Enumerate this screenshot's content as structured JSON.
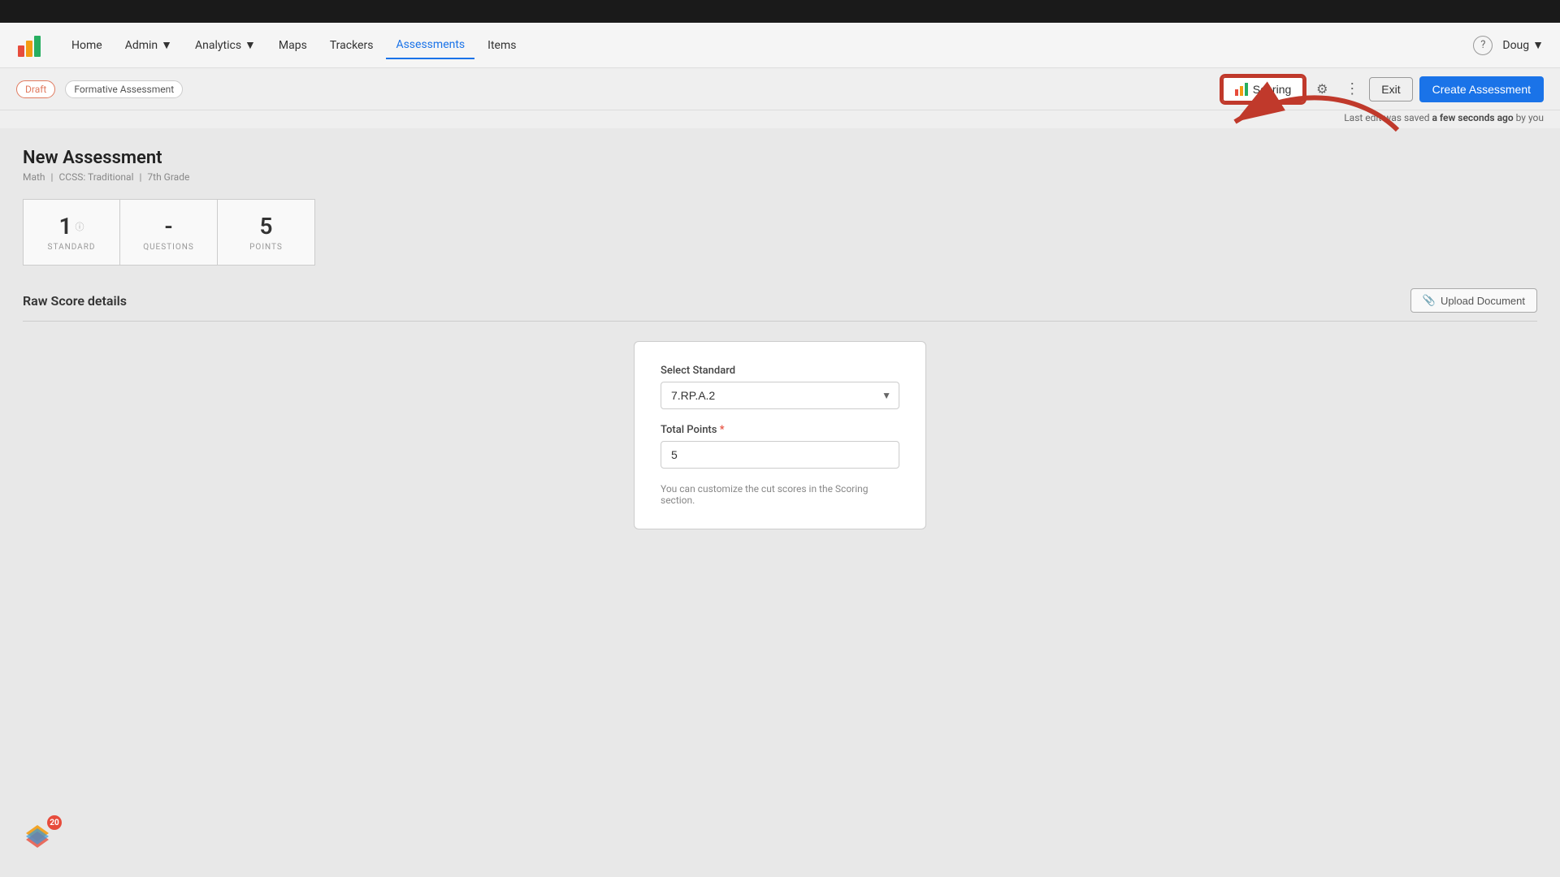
{
  "topbar": {},
  "navbar": {
    "logo_alt": "Logo",
    "links": [
      {
        "label": "Home",
        "active": false
      },
      {
        "label": "Admin",
        "active": false,
        "has_dropdown": true
      },
      {
        "label": "Analytics",
        "active": false,
        "has_dropdown": true
      },
      {
        "label": "Maps",
        "active": false
      },
      {
        "label": "Trackers",
        "active": false
      },
      {
        "label": "Assessments",
        "active": true
      },
      {
        "label": "Items",
        "active": false
      }
    ],
    "help_icon": "?",
    "user": {
      "name": "Doug",
      "dropdown": true
    }
  },
  "toolbar": {
    "badge_draft": "Draft",
    "badge_formative": "Formative Assessment",
    "scoring_label": "Scoring",
    "exit_label": "Exit",
    "create_label": "Create Assessment",
    "last_saved_prefix": "Last edit was saved ",
    "last_saved_bold": "a few seconds ago",
    "last_saved_suffix": " by you"
  },
  "assessment": {
    "title": "New Assessment",
    "meta_subject": "Math",
    "meta_separator1": "|",
    "meta_curriculum": "CCSS: Traditional",
    "meta_separator2": "|",
    "meta_grade": "7th Grade"
  },
  "stats": [
    {
      "number": "1",
      "label": "STANDARD",
      "has_info": true
    },
    {
      "number": "-",
      "label": "QUESTIONS",
      "has_info": false
    },
    {
      "number": "5",
      "label": "POINTS",
      "has_info": false
    }
  ],
  "raw_score": {
    "title": "Raw Score details",
    "upload_label": "Upload Document"
  },
  "form": {
    "select_standard_label": "Select Standard",
    "select_standard_value": "7.RP.A.2",
    "total_points_label": "Total Points",
    "total_points_value": "5",
    "hint": "You can customize the cut scores in the Scoring section."
  },
  "bottom_badge": {
    "count": "20"
  }
}
